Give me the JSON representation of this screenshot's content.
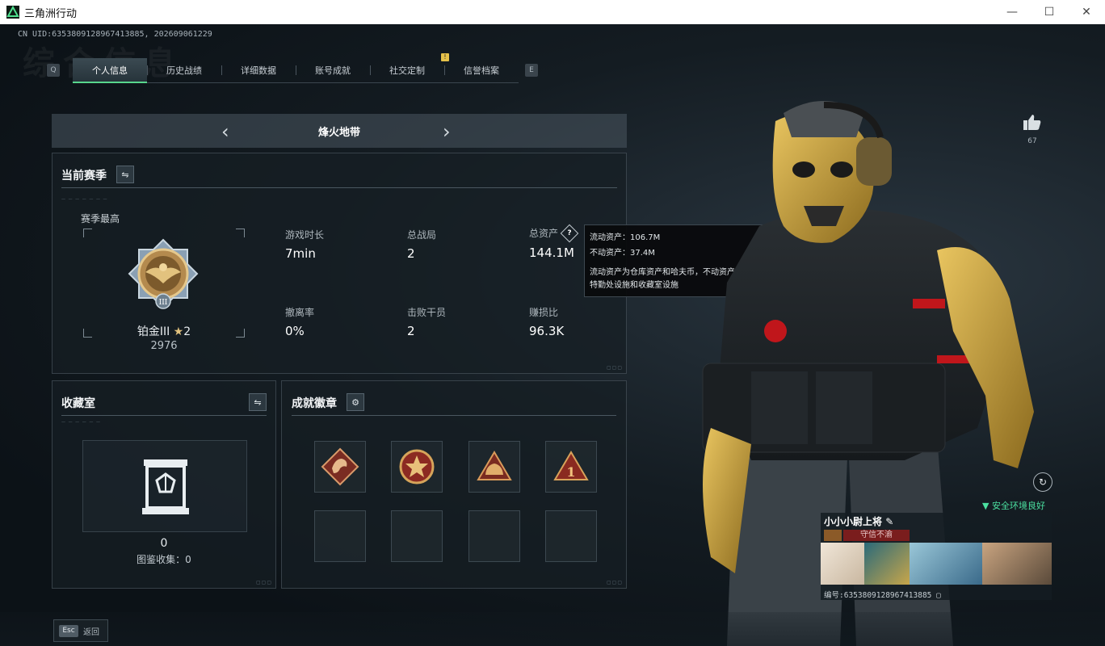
{
  "window": {
    "title": "三角洲行动",
    "minimize": "—",
    "maximize": "☐",
    "close": "✕"
  },
  "header": {
    "uid": "CN UID:6353809128967413885, 202609061229",
    "bg_text": "综合信息"
  },
  "tabs": {
    "left_key": "Q",
    "right_key": "E",
    "items": [
      "个人信息",
      "历史战绩",
      "详细数据",
      "账号成就",
      "社交定制",
      "信誉档案"
    ],
    "badge": "!"
  },
  "mode": {
    "title": "烽火地带",
    "prev": "‹",
    "next": "›"
  },
  "season": {
    "title": "当前赛季",
    "best_label": "赛季最高",
    "rank_name": "铂金III",
    "rank_stars": "2",
    "rank_score": "2976",
    "stats": [
      {
        "label": "游戏时长",
        "value": "7min"
      },
      {
        "label": "总战局",
        "value": "2"
      },
      {
        "label": "总资产",
        "value": "144.1M"
      },
      {
        "label": "撤离率",
        "value": "0%"
      },
      {
        "label": "击败干员",
        "value": "2"
      },
      {
        "label": "赚损比",
        "value": "96.3K"
      }
    ],
    "help": "?"
  },
  "tooltip": {
    "line1": "流动资产：106.7M",
    "line2": "不动资产：37.4M",
    "line3": "流动资产为仓库资产和哈夫币，不动资产为",
    "line4": "特勤处设施和收藏室设施"
  },
  "collection": {
    "title": "收藏室",
    "count": "0",
    "sub": "图鉴收集：0"
  },
  "badges": {
    "title": "成就徽章"
  },
  "profile": {
    "likes": "67",
    "safe_text": "安全环境良好",
    "name": "小小小尉上将",
    "motto": "守信不渝",
    "uid": "编号:6353809128967413885"
  },
  "footer": {
    "esc_key": "Esc",
    "back": "返回"
  },
  "colors": {
    "accent": "#58d68d",
    "tooltip_bg": "#0a0c0e",
    "motto_bg": "#7a1d1d"
  }
}
